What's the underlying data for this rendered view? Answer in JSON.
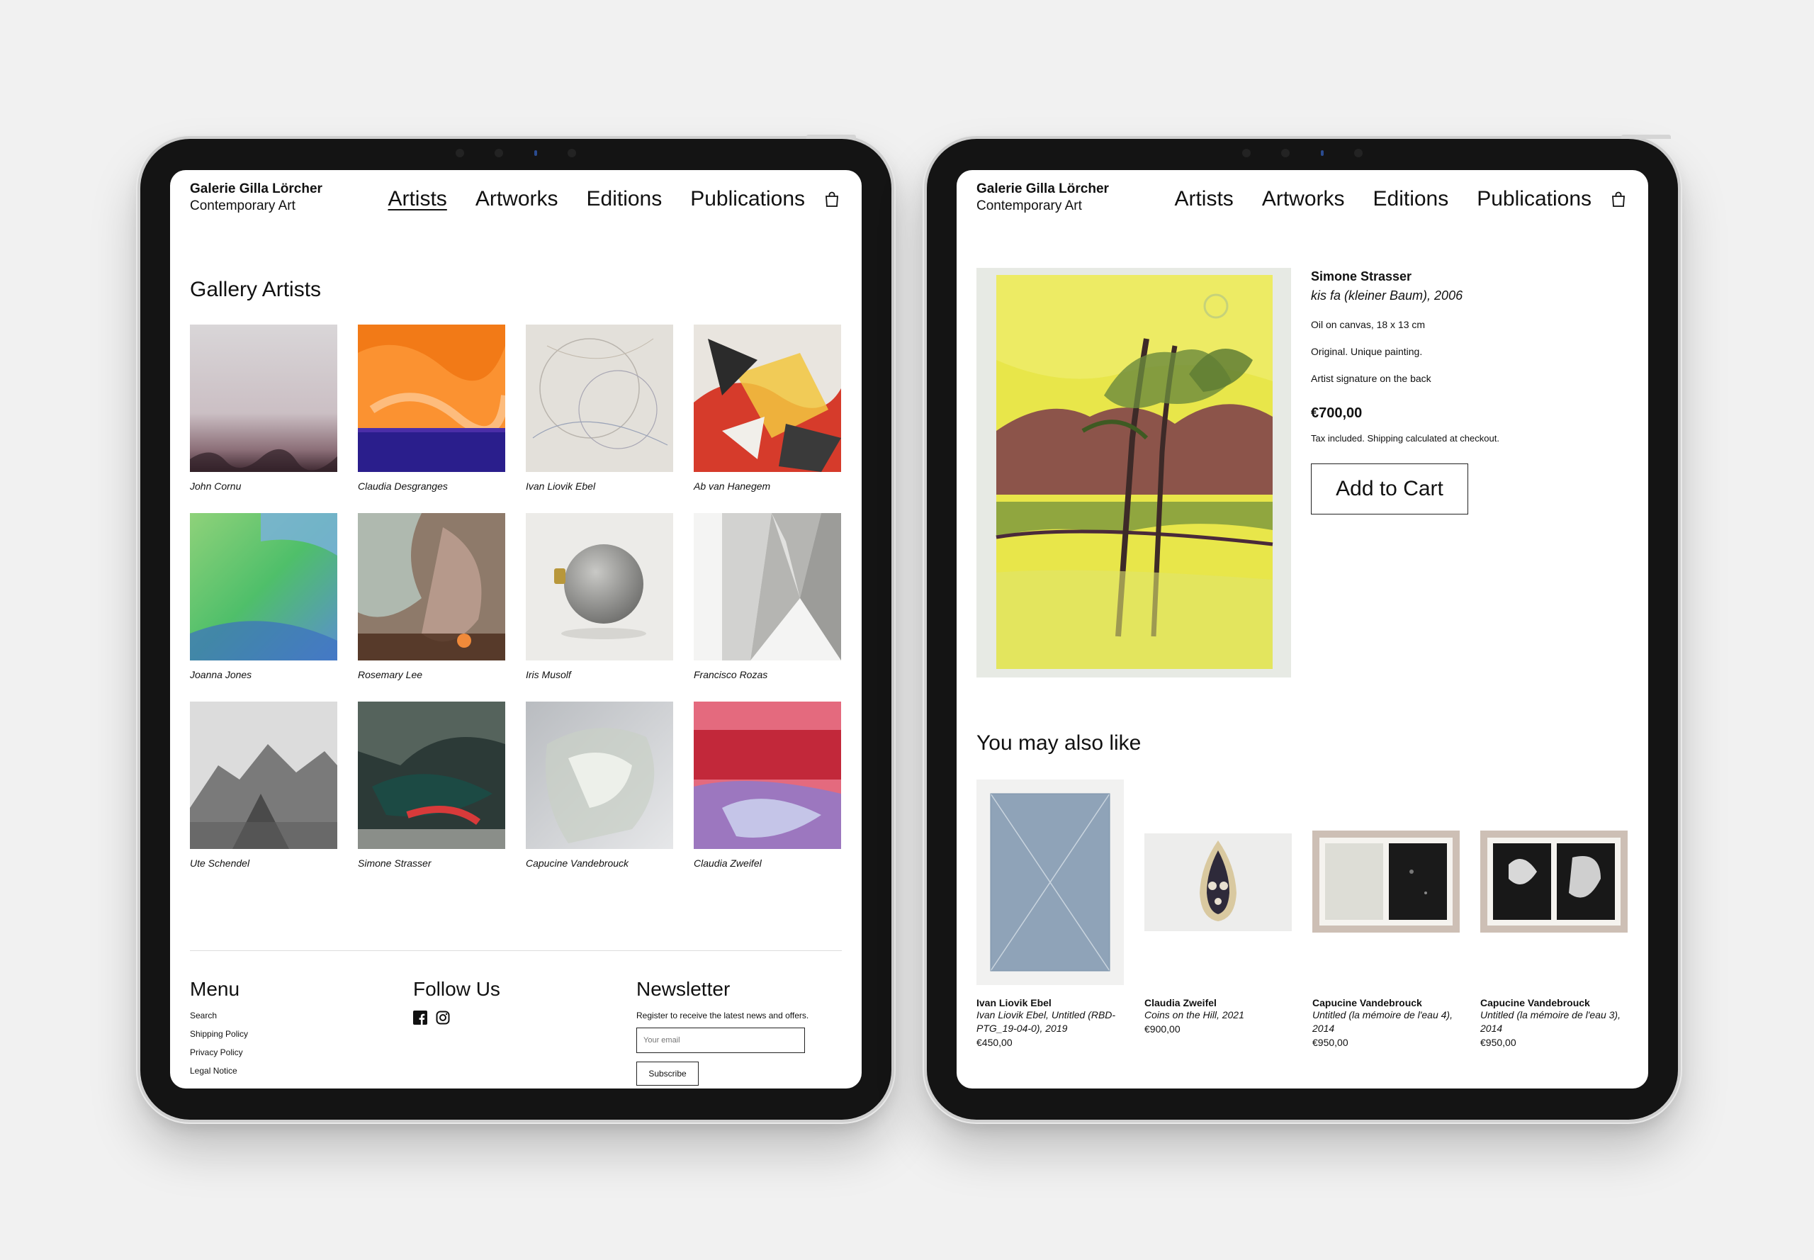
{
  "brand": {
    "name": "Galerie Gilla Lörcher",
    "tagline": "Contemporary Art"
  },
  "nav": {
    "artists": "Artists",
    "artworks": "Artworks",
    "editions": "Editions",
    "publications": "Publications"
  },
  "left_page": {
    "title": "Gallery Artists",
    "artists": [
      {
        "name": "John Cornu"
      },
      {
        "name": "Claudia Desgranges"
      },
      {
        "name": "Ivan Liovik Ebel"
      },
      {
        "name": "Ab van Hanegem"
      },
      {
        "name": "Joanna Jones"
      },
      {
        "name": "Rosemary Lee"
      },
      {
        "name": "Iris Musolf"
      },
      {
        "name": "Francisco Rozas"
      },
      {
        "name": "Ute Schendel"
      },
      {
        "name": "Simone Strasser"
      },
      {
        "name": "Capucine Vandebrouck"
      },
      {
        "name": "Claudia Zweifel"
      }
    ],
    "footer": {
      "menu_title": "Menu",
      "menu_links": [
        "Search",
        "Shipping Policy",
        "Privacy Policy",
        "Legal Notice"
      ],
      "follow_title": "Follow Us",
      "newsletter_title": "Newsletter",
      "newsletter_text": "Register to receive the latest news and offers.",
      "email_placeholder": "Your email",
      "subscribe": "Subscribe"
    }
  },
  "right_page": {
    "product": {
      "artist": "Simone Strasser",
      "title": "kis fa (kleiner Baum), 2006",
      "details": [
        "Oil on canvas, 18 x 13 cm",
        "Original. Unique painting.",
        "Artist signature on the back"
      ],
      "price": "€700,00",
      "tax_note": "Tax included. Shipping calculated at checkout.",
      "add_to_cart": "Add to Cart"
    },
    "also_title": "You may also like",
    "recommendations": [
      {
        "artist": "Ivan Liovik Ebel",
        "title": "Ivan Liovik Ebel, Untitled (RBD-PTG_19-04-0), 2019",
        "price": "€450,00"
      },
      {
        "artist": "Claudia Zweifel",
        "title": "Coins on the Hill, 2021",
        "price": "€900,00"
      },
      {
        "artist": "Capucine Vandebrouck",
        "title": "Untitled (la mémoire de l'eau 4), 2014",
        "price": "€950,00"
      },
      {
        "artist": "Capucine Vandebrouck",
        "title": "Untitled (la mémoire de l'eau 3), 2014",
        "price": "€950,00"
      }
    ]
  }
}
